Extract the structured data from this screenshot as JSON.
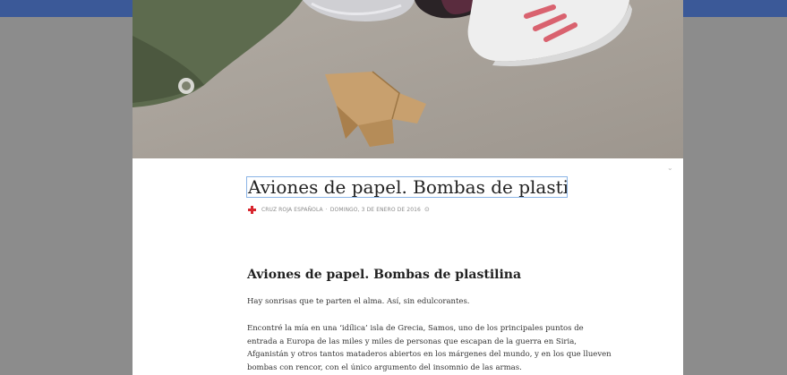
{
  "post": {
    "title": "Aviones de papel. Bombas de plastilina",
    "author": "CRUZ ROJA ESPAÑOLA",
    "separator": "·",
    "date": "DOMINGO, 3 DE ENERO DE 2016",
    "audience_icon": "globe-icon",
    "heading": "Aviones de papel. Bombas de plastilina",
    "paragraph_1": "Hay sonrisas que te parten el alma. Así, sin edulcorantes.",
    "paragraph_2_lines": [
      "Encontré la mía en una ‘idílica’ isla de Grecia, Samos, uno de los principales puntos de",
      "entrada a Europa de las miles y miles de personas que escapan de la guerra en Siria,",
      "Afganistán y otros tantos mataderos abiertos en los márgenes del mundo, y en los que llueven",
      "bombas con rencor, con el único argumento del insomnio de las armas."
    ]
  },
  "colors": {
    "topbar": "#3b5998",
    "backdrop": "#8c8c8c",
    "logo_red": "#d8262e"
  }
}
